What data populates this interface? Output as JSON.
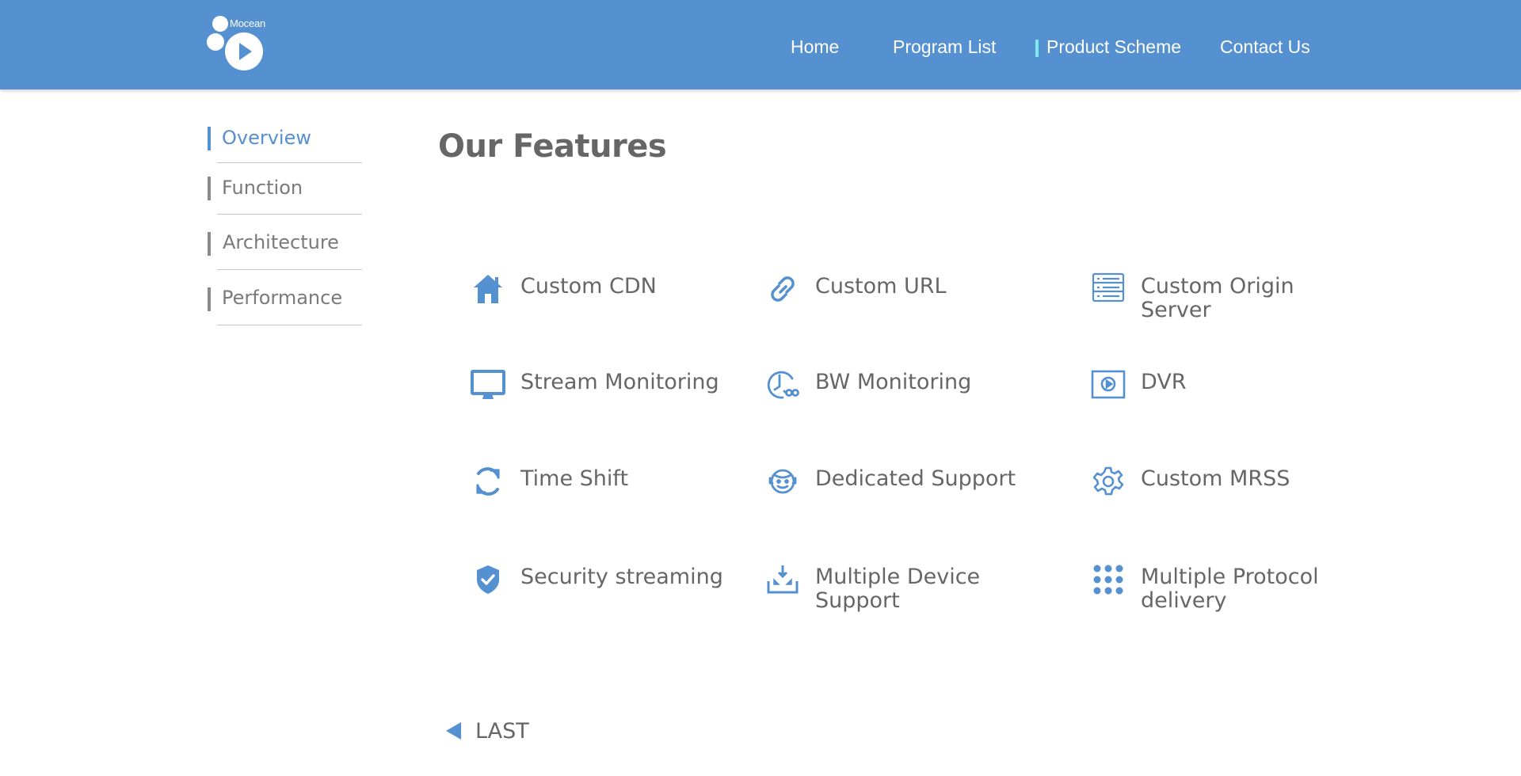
{
  "header": {
    "logo_text": "Mocean",
    "nav": [
      {
        "label": "Home"
      },
      {
        "label": "Program List"
      },
      {
        "label": "Product Scheme"
      },
      {
        "label": "Contact Us"
      }
    ],
    "active_nav": "Product Scheme"
  },
  "sidebar": {
    "items": [
      {
        "label": "Overview",
        "active": true
      },
      {
        "label": "Function",
        "active": false
      },
      {
        "label": "Architecture",
        "active": false
      },
      {
        "label": "Performance",
        "active": false
      }
    ]
  },
  "main": {
    "title": "Our Features",
    "features": [
      {
        "label": "Custom CDN",
        "icon": "home-icon"
      },
      {
        "label": "Custom URL",
        "icon": "link-icon"
      },
      {
        "label": "Custom Origin Server",
        "icon": "server-icon"
      },
      {
        "label": "Stream Monitoring",
        "icon": "monitor-icon"
      },
      {
        "label": "BW Monitoring",
        "icon": "bandwidth-clock-icon"
      },
      {
        "label": "DVR",
        "icon": "play-box-icon"
      },
      {
        "label": "Time Shift",
        "icon": "refresh-icon"
      },
      {
        "label": "Dedicated Support",
        "icon": "support-agent-icon"
      },
      {
        "label": "Custom MRSS",
        "icon": "gear-icon"
      },
      {
        "label": "Security streaming",
        "icon": "shield-check-icon"
      },
      {
        "label": "Multiple Device Support",
        "icon": "download-tray-icon"
      },
      {
        "label": "Multiple Protocol delivery",
        "icon": "dots-grid-icon"
      }
    ],
    "pager": {
      "last_label": "LAST"
    }
  },
  "colors": {
    "header_bg": "#5590d0",
    "accent": "#5590d0",
    "active_nav_marker": "#7de8f0",
    "text": "#666666"
  }
}
